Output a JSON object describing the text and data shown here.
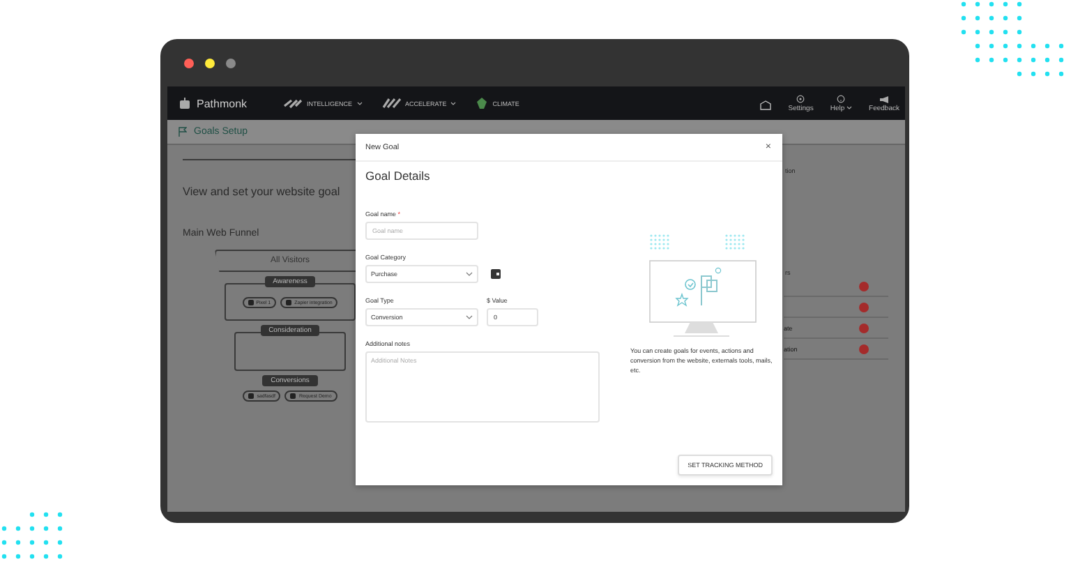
{
  "window": {
    "controls": [
      {
        "color": "#ff5f57"
      },
      {
        "color": "#ffeb3b"
      },
      {
        "color": "#8a8a8a"
      }
    ]
  },
  "nav": {
    "brand": "Pathmonk",
    "items": [
      {
        "label": "INTELLIGENCE",
        "caret": true
      },
      {
        "label": "ACCELERATE",
        "caret": true
      },
      {
        "label": "CLIMATE",
        "caret": false
      }
    ],
    "right": [
      {
        "label": "Settings",
        "caret": false
      },
      {
        "label": "Help",
        "caret": true
      },
      {
        "label": "Feedback",
        "caret": false
      }
    ]
  },
  "subheader": {
    "title": "Goals Setup"
  },
  "page": {
    "heading": "View and set your website goal",
    "funnel_title": "Main Web Funnel",
    "top_stage": "All Visitors",
    "stages": [
      {
        "label": "Awareness",
        "kind": "box",
        "chips": [
          "Pixel 1",
          "Zapier integration"
        ]
      },
      {
        "label": "Consideration",
        "kind": "box"
      },
      {
        "label": "Conversions",
        "kind": "open",
        "chips": [
          "sadfasdf",
          "Request Demo"
        ]
      }
    ],
    "right_fragments": [
      "tion",
      "rs"
    ],
    "right_rows": [
      {
        "alert": true
      },
      {
        "alert": true
      },
      {
        "text": "ate",
        "alert": true
      },
      {
        "text": "ation",
        "alert": true
      }
    ]
  },
  "modal": {
    "title": "New Goal",
    "close": "×",
    "heading": "Goal Details",
    "name_label": "Goal name",
    "required_mark": "*",
    "name_placeholder": "Goal name",
    "category_label": "Goal Category",
    "category_value": "Purchase",
    "type_label": "Goal Type",
    "type_value": "Conversion",
    "value_label": "$ Value",
    "value": "0",
    "notes_label": "Additional notes",
    "notes_placeholder": "Additional Notes",
    "info": "You can create goals for events, actions and conversion from the website, externals tools, mails, etc.",
    "button": "SET TRACKING METHOD"
  }
}
